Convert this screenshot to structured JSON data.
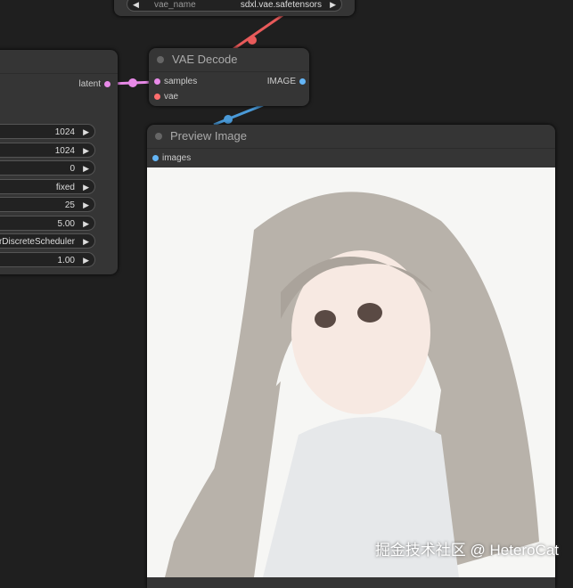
{
  "vae_loader": {
    "widget_name": "vae_name",
    "widget_value": "sdxl.vae.safetensors"
  },
  "sampler_node": {
    "output": "latent",
    "widgets": [
      "1024",
      "1024",
      "0",
      "fixed",
      "25",
      "5.00",
      "erDiscreteScheduler",
      "1.00"
    ]
  },
  "vae_decode": {
    "title": "VAE Decode",
    "inputs": [
      "samples",
      "vae"
    ],
    "output": "IMAGE"
  },
  "preview": {
    "title": "Preview Image",
    "input": "images"
  },
  "watermark": "掘金技术社区 @ HeteroCat",
  "colors": {
    "latent": "#e88ae8",
    "vae": "#ff6e6e",
    "image": "#64b5f6"
  }
}
